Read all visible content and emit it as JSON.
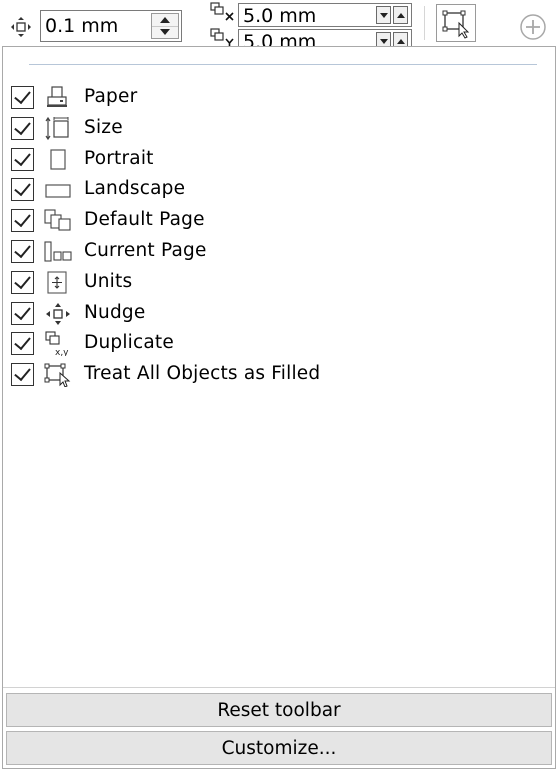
{
  "toolbar": {
    "nudge_value": "0.1 mm",
    "duplicate_x_value": "5.0 mm",
    "duplicate_y_value": "5.0 mm"
  },
  "menu": {
    "items": [
      {
        "label": "Paper",
        "checked": true,
        "icon": "printer-icon"
      },
      {
        "label": "Size",
        "checked": true,
        "icon": "page-size-icon"
      },
      {
        "label": "Portrait",
        "checked": true,
        "icon": "portrait-icon"
      },
      {
        "label": "Landscape",
        "checked": true,
        "icon": "landscape-icon"
      },
      {
        "label": "Default Page",
        "checked": true,
        "icon": "default-page-icon"
      },
      {
        "label": "Current Page",
        "checked": true,
        "icon": "current-page-icon"
      },
      {
        "label": "Units",
        "checked": true,
        "icon": "units-icon"
      },
      {
        "label": "Nudge",
        "checked": true,
        "icon": "nudge-icon"
      },
      {
        "label": "Duplicate",
        "checked": true,
        "icon": "duplicate-icon"
      },
      {
        "label": "Treat All Objects as Filled",
        "checked": true,
        "icon": "treat-filled-icon"
      }
    ],
    "reset_label": "Reset toolbar",
    "customize_label": "Customize..."
  }
}
